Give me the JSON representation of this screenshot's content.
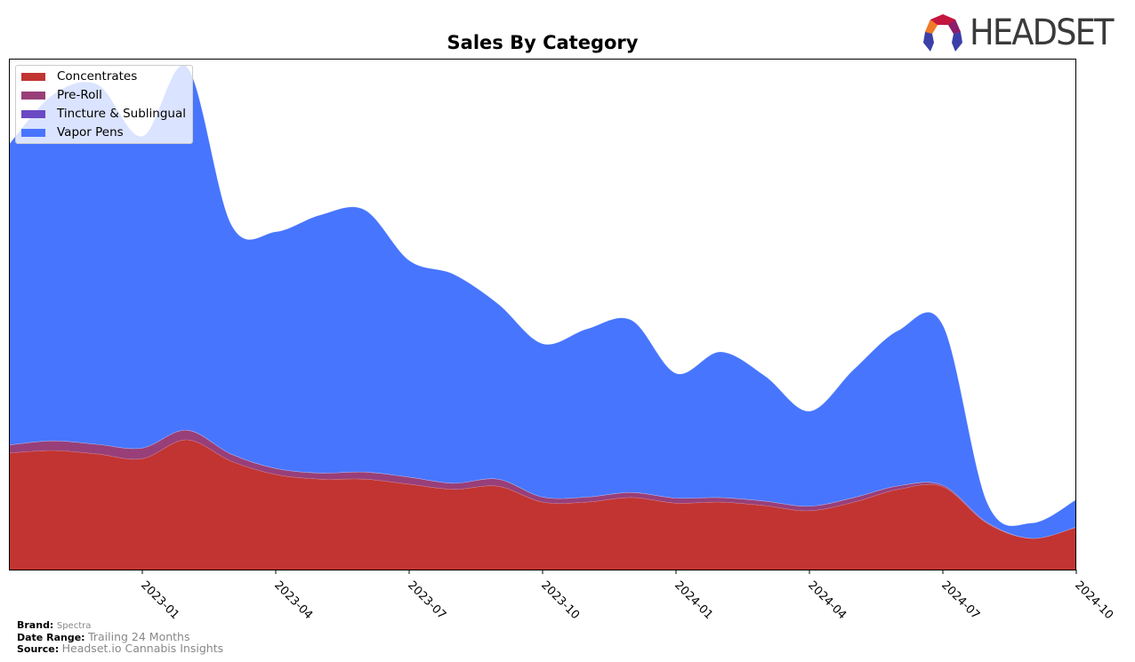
{
  "header": {
    "logo_text": "HEADSET"
  },
  "footer": {
    "brand_label": "Brand:",
    "brand_value": "Spectra",
    "date_range_label": "Date Range:",
    "date_range_value": "Trailing 24 Months",
    "source_label": "Source:",
    "source_value": "Headset.io Cannabis Insights"
  },
  "chart_data": {
    "type": "area",
    "stacked": true,
    "smooth": true,
    "title": "Sales By Category",
    "xlabel": "",
    "ylabel": "",
    "y_ticks_visible": false,
    "grid": false,
    "legend_position": "top-left",
    "x": [
      "2022-10",
      "2022-11",
      "2022-12",
      "2023-01",
      "2023-02",
      "2023-03",
      "2023-04",
      "2023-05",
      "2023-06",
      "2023-07",
      "2023-08",
      "2023-09",
      "2023-10",
      "2023-11",
      "2023-12",
      "2024-01",
      "2024-02",
      "2024-03",
      "2024-04",
      "2024-05",
      "2024-06",
      "2024-07",
      "2024-08",
      "2024-09",
      "2024-10"
    ],
    "x_tick_labels": [
      "2023-01",
      "2023-04",
      "2023-07",
      "2023-10",
      "2024-01",
      "2024-04",
      "2024-07",
      "2024-10"
    ],
    "ylim": [
      0,
      100
    ],
    "series": [
      {
        "name": "Concentrates",
        "color": "#c13432",
        "values": [
          22.8,
          23.3,
          22.6,
          21.7,
          25.4,
          21.2,
          18.6,
          17.7,
          17.7,
          16.7,
          15.7,
          16.3,
          13.2,
          13.2,
          14.1,
          13.0,
          13.2,
          12.5,
          11.5,
          13.2,
          15.7,
          16.2,
          9.0,
          6.1,
          8.3
        ]
      },
      {
        "name": "Pre-Roll",
        "color": "#983f79",
        "values": [
          1.6,
          1.9,
          1.9,
          2.1,
          1.9,
          1.4,
          1.2,
          1.2,
          1.4,
          1.4,
          1.2,
          1.4,
          1.0,
          1.0,
          1.0,
          1.0,
          0.9,
          0.9,
          0.9,
          0.9,
          0.7,
          0.3,
          0.2,
          0.0,
          0.0
        ]
      },
      {
        "name": "Tincture & Sublingual",
        "color": "#6a49c4",
        "values": [
          0,
          0,
          0,
          0,
          0,
          0,
          0,
          0,
          0,
          0,
          0,
          0,
          0,
          0,
          0,
          0,
          0,
          0,
          0,
          0,
          0,
          0,
          0,
          0,
          0
        ]
      },
      {
        "name": "Vapor Pens",
        "color": "#4775fe",
        "values": [
          58.8,
          67.8,
          70.4,
          61.0,
          71.1,
          44.9,
          46.3,
          50.5,
          51.3,
          42.4,
          40.9,
          34.3,
          30.0,
          32.9,
          33.7,
          24.4,
          28.5,
          24.5,
          18.6,
          25.1,
          30.4,
          31.3,
          3.8,
          3.0,
          5.4
        ]
      }
    ]
  }
}
